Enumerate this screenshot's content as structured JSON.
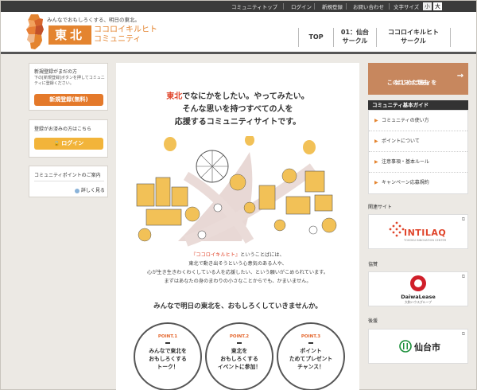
{
  "topbar": {
    "links": [
      "コミュニティトップ",
      "ログイン",
      "新規登録",
      "お問い合わせ"
    ],
    "text_size_label": "文字サイズ",
    "size_small": "小",
    "size_large": "大"
  },
  "header": {
    "tagline": "みんなでおもしろくする、明日の東北。",
    "logo_badge": "東北",
    "logo_name_line1": "ココロイキルヒト",
    "logo_name_line2": "コミュニティ",
    "nav": [
      {
        "line1": "TOP",
        "line2": ""
      },
      {
        "line1": "01：仙台",
        "line2": "サークル"
      },
      {
        "line1": "ココロイキルヒト",
        "line2": "サークル"
      }
    ]
  },
  "left": {
    "register_title": "新規登録がまだの方",
    "register_desc": "下の[新規登録]ボタンを押してコミュニティに登録ください。",
    "register_button": "新規登録(無料)",
    "login_title": "登録がお済みの方はこちら",
    "login_button": "ログイン",
    "points_title": "コミュニティポイントのご案内",
    "points_link": "詳しく見る"
  },
  "main": {
    "lead_highlight": "東北",
    "lead_line1_rest": "でなにかをしたい。やってみたい。",
    "lead_line2": "そんな思いを持つすべての人を",
    "lead_line3": "応援するコミュニティサイトです。",
    "body_highlight": "『ココロイキルヒト』",
    "body_line1_rest": "ということばには、",
    "body_line2": "東北で動き出そうという心意気のある人や、",
    "body_line3": "心が生き生きわくわくしている人を応援したい、という願いがこめられています。",
    "body_line4": "まずはあなたの身のまわりの小さなことからでも、かまいません。",
    "closing": "みんなで明日の東北を、おもしろくしていきませんか。",
    "points": [
      {
        "num": "POINT.1",
        "l1": "みんなで東北を",
        "l2": "おもしろくする",
        "l3": "トーク！"
      },
      {
        "num": "POINT.2",
        "l1": "東北を",
        "l2": "おもしろくする",
        "l3": "イベントに参加！"
      },
      {
        "num": "POINT.3",
        "l1": "ポイント",
        "l2": "ためてプレゼント",
        "l3": "チャンス！"
      }
    ]
  },
  "right": {
    "reason_line1": "このコミュニティを",
    "reason_line2": "はじめた理由",
    "guide_title": "コミュニティ基本ガイド",
    "guide_items": [
      "コミュニティの使い方",
      "ポイントについて",
      "注意事項・基本ルール",
      "キャンペーン応募規約"
    ],
    "related_label": "関連サイト",
    "intilaq": "INTILAQ",
    "intilaq_sub": "TOHOKU INNOVATION CENTER",
    "sponsor_label": "協賛",
    "daiwa": "DaiwaLease",
    "daiwa_sub": "大和ハウスグループ",
    "support_label": "後援",
    "sendai": "仙台市"
  },
  "colors": {
    "accent": "#e4842f",
    "highlight": "#e0452b",
    "topbar": "#3b3b3b"
  }
}
